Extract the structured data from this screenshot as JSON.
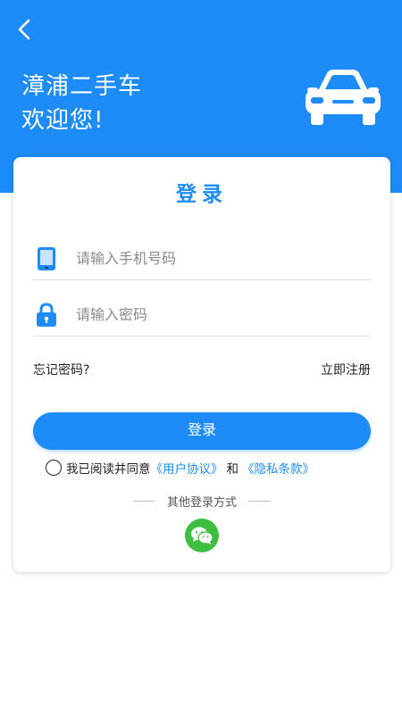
{
  "header": {
    "welcome_line1": "漳浦二手车",
    "welcome_line2": "欢迎您!",
    "back_icon": "chevron-left-icon",
    "brand_icon": "car-icon"
  },
  "login": {
    "title": "登录",
    "phone_placeholder": "请输入手机号码",
    "password_placeholder": "请输入密码",
    "forgot_password": "忘记密码?",
    "register": "立即注册",
    "submit": "登录"
  },
  "agreement": {
    "prefix": "我已阅读并同意",
    "user_agreement": "《用户协议》",
    "and": "和",
    "privacy_policy": "《隐私条款》",
    "checked": false
  },
  "other_login": {
    "label": "其他登录方式",
    "wechat_icon": "wechat-icon"
  },
  "colors": {
    "primary": "#1d8cf8",
    "wechat": "#3fbe3f"
  }
}
